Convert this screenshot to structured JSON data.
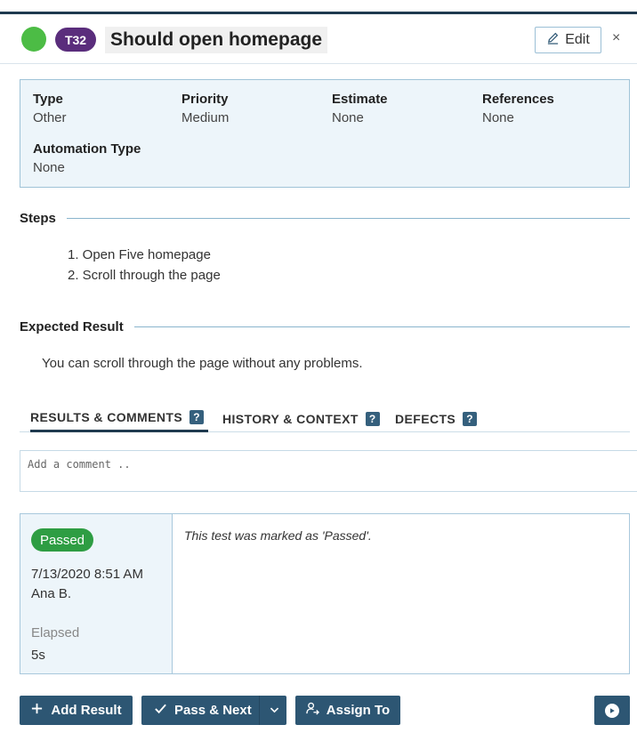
{
  "header": {
    "status_color": "#4cbc45",
    "test_id": "T32",
    "title": "Should open homepage",
    "edit_label": "Edit",
    "close_glyph": "×"
  },
  "info": {
    "type_label": "Type",
    "type_value": "Other",
    "priority_label": "Priority",
    "priority_value": "Medium",
    "estimate_label": "Estimate",
    "estimate_value": "None",
    "references_label": "References",
    "references_value": "None",
    "automation_label": "Automation Type",
    "automation_value": "None"
  },
  "steps": {
    "heading": "Steps",
    "items": [
      "1. Open Five homepage",
      "2. Scroll through the page"
    ]
  },
  "expected": {
    "heading": "Expected Result",
    "text": "You can scroll through the page without any problems."
  },
  "tabs": [
    {
      "label": "RESULTS & COMMENTS",
      "active": true
    },
    {
      "label": "HISTORY & CONTEXT",
      "active": false
    },
    {
      "label": "DEFECTS",
      "active": false
    }
  ],
  "help_glyph": "?",
  "comment": {
    "placeholder": "Add a comment .."
  },
  "result": {
    "status": "Passed",
    "status_color": "#2e9d43",
    "date": "7/13/2020 8:51 AM",
    "user": "Ana B.",
    "elapsed_label": "Elapsed",
    "elapsed_value": "5s",
    "message": "This test was marked as 'Passed'."
  },
  "actions": {
    "add_result": "Add Result",
    "pass_next": "Pass & Next",
    "assign_to": "Assign To"
  },
  "icons": {
    "edit": "pencil-icon",
    "close": "close-icon",
    "add": "plus-icon",
    "pass": "check-icon",
    "dropdown": "chevron-down-icon",
    "assign": "assign-user-icon",
    "run": "play-icon"
  }
}
